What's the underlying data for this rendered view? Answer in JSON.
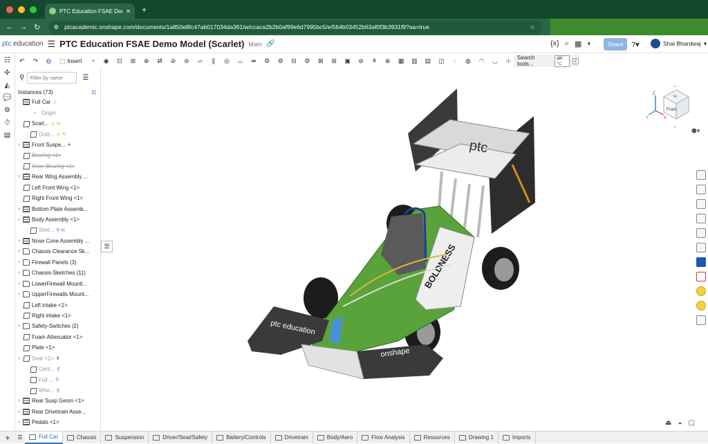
{
  "browser": {
    "tab_title": "PTC Education FSAE Demo M",
    "new_tab": "+",
    "url": "ptcacademic.onshape.com/documents/1a850e8fc47ab017034da361/w/ccaca2b2b0af99e6d7995bc5/e/564b03452b63af0f3b3931f9?aa=true",
    "colors": {
      "chrome": "#15472d",
      "bar": "#2a6645",
      "close": "#ff5f57",
      "min": "#febc2e",
      "max": "#28c840"
    }
  },
  "app": {
    "logo_ptc": "ptc",
    "logo_edu": "education",
    "doc_title": "PTC Education FSAE Demo Model (Scarlet)",
    "branch": "Main",
    "share_label": "Share",
    "user_name": "Shai Bhardwaj",
    "insert_label": "Insert",
    "search_tools_label": "Search tools...",
    "search_shortcut_1": "alt/⌥",
    "search_shortcut_2": "c"
  },
  "instances_panel": {
    "filter_placeholder": "Filter by name",
    "header": "Instances (73)",
    "items": [
      {
        "label": "Full Car",
        "arrow": "",
        "icon": "asm",
        "state": "normal",
        "badge": "⚠"
      },
      {
        "label": "Origin",
        "arrow": "",
        "icon": "dot",
        "state": "dim",
        "badge": ""
      },
      {
        "label": "Scarl...",
        "arrow": "",
        "icon": "part",
        "state": "normal",
        "badge": "⚠ ⇆"
      },
      {
        "label": "Outli...",
        "arrow": "",
        "icon": "part",
        "state": "dim",
        "badge": "⚠ ⇆"
      },
      {
        "label": "Front Suspe...",
        "arrow": "›",
        "icon": "asm",
        "state": "normal",
        "badge": "●"
      },
      {
        "label": "Bearing <1>",
        "arrow": "",
        "icon": "part",
        "state": "strike",
        "badge": ""
      },
      {
        "label": "Inner Bearing <1>",
        "arrow": "",
        "icon": "part",
        "state": "strike",
        "badge": ""
      },
      {
        "label": "Rear Wing Assembly ...",
        "arrow": "›",
        "icon": "asm",
        "state": "normal",
        "badge": ""
      },
      {
        "label": "Left Front Wing <1>",
        "arrow": "",
        "icon": "part",
        "state": "normal",
        "badge": ""
      },
      {
        "label": "Right Front Wing <1>",
        "arrow": "",
        "icon": "part",
        "state": "normal",
        "badge": ""
      },
      {
        "label": "Bottom Plate Assemb...",
        "arrow": "›",
        "icon": "asm",
        "state": "normal",
        "badge": ""
      },
      {
        "label": "Body Assembly <1>",
        "arrow": "›",
        "icon": "asm",
        "state": "normal",
        "badge": ""
      },
      {
        "label": "Sket...",
        "arrow": "",
        "icon": "part",
        "state": "dim",
        "badge": "⚲ ⇆"
      },
      {
        "label": "Nose Cone Assembly ...",
        "arrow": "›",
        "icon": "asm",
        "state": "normal",
        "badge": ""
      },
      {
        "label": "Chassis Clearance Sk...",
        "arrow": "›",
        "icon": "folder",
        "state": "normal",
        "badge": ""
      },
      {
        "label": "Firewall Panels (3)",
        "arrow": "›",
        "icon": "folder",
        "state": "normal",
        "badge": ""
      },
      {
        "label": "Chassis-Sketches (11)",
        "arrow": "›",
        "icon": "folder",
        "state": "normal",
        "badge": ""
      },
      {
        "label": "LowerFirewall Mounti...",
        "arrow": "›",
        "icon": "folder",
        "state": "normal",
        "badge": ""
      },
      {
        "label": "UpperFirewalls Mount...",
        "arrow": "›",
        "icon": "folder",
        "state": "normal",
        "badge": ""
      },
      {
        "label": "Left intake <1>",
        "arrow": "",
        "icon": "part",
        "state": "normal",
        "badge": ""
      },
      {
        "label": "Right intake <1>",
        "arrow": "",
        "icon": "part",
        "state": "normal",
        "badge": ""
      },
      {
        "label": "Safety-Switches (2)",
        "arrow": "›",
        "icon": "folder",
        "state": "normal",
        "badge": ""
      },
      {
        "label": "Foam Attenuator <1>",
        "arrow": "",
        "icon": "part",
        "state": "normal",
        "badge": ""
      },
      {
        "label": "Plate <1>",
        "arrow": "",
        "icon": "part",
        "state": "normal",
        "badge": ""
      },
      {
        "label": "Seat <1>",
        "arrow": "›",
        "icon": "part",
        "state": "dim",
        "badge": "⬇"
      },
      {
        "label": "Cent...",
        "arrow": "",
        "icon": "part",
        "state": "dim",
        "badge": "⚲"
      },
      {
        "label": "Foil ...",
        "arrow": "",
        "icon": "part",
        "state": "dim",
        "badge": "⚲"
      },
      {
        "label": "Whe...",
        "arrow": "",
        "icon": "part",
        "state": "dim",
        "badge": "⚲"
      },
      {
        "label": "Rear Susp Geom <1>",
        "arrow": "›",
        "icon": "asm",
        "state": "normal",
        "badge": ""
      },
      {
        "label": "Rear Drivetrain Asse...",
        "arrow": "›",
        "icon": "asm",
        "state": "normal",
        "badge": ""
      },
      {
        "label": "Pedals <1>",
        "arrow": "›",
        "icon": "asm",
        "state": "normal",
        "badge": ""
      }
    ]
  },
  "model": {
    "front_wing_text": "ptc education",
    "side_text": "BOLDNESS",
    "rear_wing_text": "ptc",
    "floor_text": "onshape"
  },
  "navcube": {
    "front": "Front",
    "top": "Top",
    "x": "X",
    "y": "Y",
    "z": "Z"
  },
  "tabs": [
    {
      "label": "Full Car",
      "active": true
    },
    {
      "label": "Chassis"
    },
    {
      "label": "Suspension"
    },
    {
      "label": "Driver/Seat/Safety"
    },
    {
      "label": "Battery/Controls"
    },
    {
      "label": "Drivetrain"
    },
    {
      "label": "Body/Aero"
    },
    {
      "label": "Flow Analysis"
    },
    {
      "label": "Resources"
    },
    {
      "label": "Drawing 1"
    },
    {
      "label": "Imports"
    }
  ]
}
